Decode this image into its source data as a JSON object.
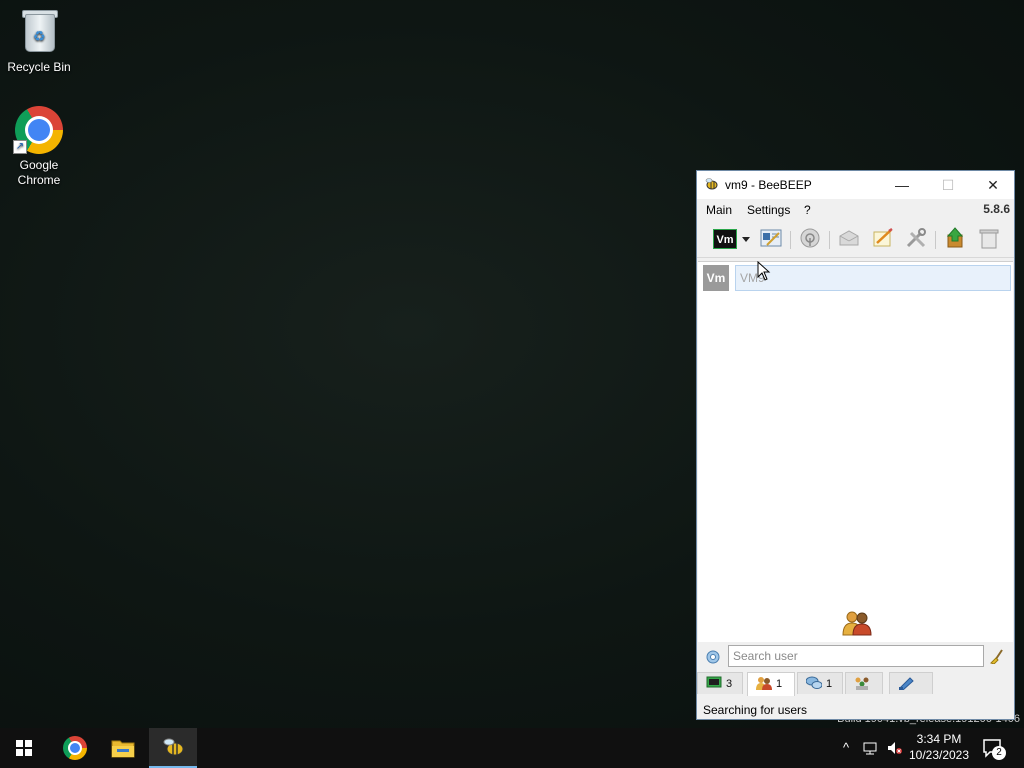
{
  "desktop": {
    "icons": [
      {
        "label": "Recycle Bin"
      },
      {
        "label": "Google Chrome"
      }
    ],
    "build_text": "Build 19041.vb_release.191206-1406"
  },
  "window": {
    "title": "vm9 - BeeBEEP",
    "version": "5.8.6",
    "menu": {
      "main": "Main",
      "settings": "Settings",
      "help": "?"
    },
    "toolbar": {
      "user_badge": "Vm"
    },
    "users": [
      {
        "avatar": "Vm",
        "name": "VM9"
      }
    ],
    "search": {
      "placeholder": "Search user",
      "value": ""
    },
    "tabs": [
      {
        "count": "3"
      },
      {
        "count": "1"
      },
      {
        "count": "1"
      },
      {
        "count": ""
      },
      {
        "count": ""
      }
    ],
    "status": "Searching for users"
  },
  "taskbar": {
    "time": "3:34 PM",
    "date": "10/23/2023",
    "notifications": "2"
  },
  "colors": {
    "accent": "#76b9ed",
    "taskbar": "#101010",
    "window_bg": "#f0f0f0"
  }
}
